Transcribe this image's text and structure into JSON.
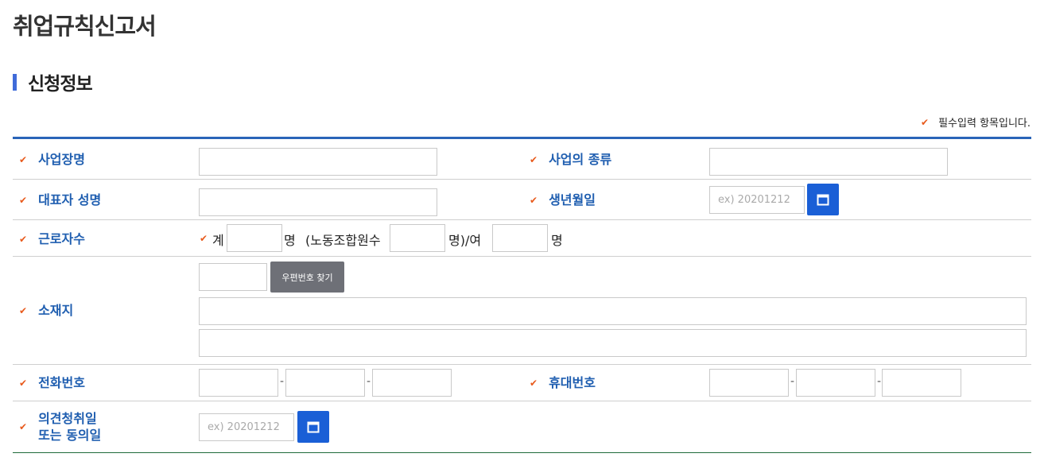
{
  "page": {
    "title": "취업규칙신고서"
  },
  "section": {
    "title": "신청정보"
  },
  "required_note": "필수입력 항목입니다.",
  "form": {
    "business_name": {
      "label": "사업장명",
      "value": ""
    },
    "business_type": {
      "label": "사업의 종류",
      "value": ""
    },
    "representative": {
      "label": "대표자 성명",
      "value": ""
    },
    "birth_date": {
      "label": "생년월일",
      "placeholder": "ex) 20201212",
      "value": ""
    },
    "workers": {
      "label": "근로자수",
      "total_prefix": "계",
      "unit_person": "명",
      "union_label": "(노동조합원수",
      "union_suffix": "명)/여",
      "total": "",
      "union": "",
      "female": ""
    },
    "address": {
      "label": "소재지",
      "zip_button": "우편번호 찾기",
      "zip": "",
      "line1": "",
      "line2": ""
    },
    "phone": {
      "label": "전화번호",
      "sep": "-",
      "parts": [
        "",
        "",
        ""
      ]
    },
    "mobile": {
      "label": "휴대번호",
      "sep": "-",
      "parts": [
        "",
        "",
        ""
      ]
    },
    "opinion_date": {
      "label_line1": "의견청취일",
      "label_line2": "또는 동의일",
      "placeholder": "ex) 20201212",
      "value": ""
    }
  },
  "icons": {
    "check": "check-icon",
    "calendar": "calendar-icon"
  },
  "colors": {
    "accent_blue": "#1a5fd6",
    "label_blue": "#1f5eb0",
    "check_orange": "#e85a1c",
    "zip_button_gray": "#6e7077"
  }
}
